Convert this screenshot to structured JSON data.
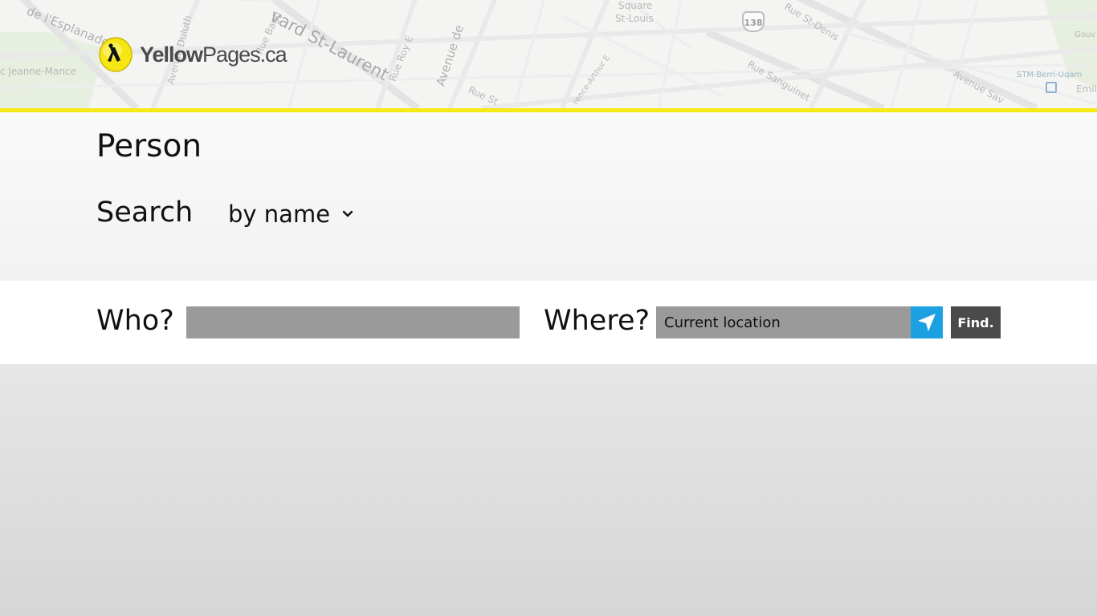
{
  "map": {
    "labels": {
      "esplanade": "de l'Esplanade",
      "jeanne_mance": "c Jeanne-Mance",
      "duluth": "Avenue Duluth",
      "bagg": "Rue Bagg",
      "st_laurent": "vard St-Laurent",
      "roy": "Rue Roy E",
      "avenue_de": "Avenue de",
      "rue_st": "Rue St",
      "arthur": "rence-Arthur E",
      "square": "Square",
      "st_louis": "St-Louis",
      "st_denis": "Rue St-Denis",
      "sanguinet": "Rue Sanguinet",
      "avenue_sav": "Avenue Sav",
      "stm": "STM-Berri-Uqam",
      "emil": "Emil",
      "gouv": "Gouv"
    },
    "route_number": "138",
    "colors": {
      "background": "#f4f4f2",
      "road": "#e6e6e6",
      "park": "#e6efe0"
    }
  },
  "header": {
    "logo": {
      "text_bold": "Yellow",
      "text_regular": "Pages.ca",
      "badge_color": "#f5e614"
    },
    "accent_line_color": "#f5ea14"
  },
  "page": {
    "title": "Person",
    "search_label": "Search",
    "search_mode": {
      "selected": "by name",
      "icon": "chevron-down-icon"
    }
  },
  "search": {
    "who_label": "Who?",
    "who_value": "",
    "where_label": "Where?",
    "where_value": "Current location",
    "locate_icon": "location-arrow-icon",
    "locate_color": "#1ba1e2",
    "find_label": "Find."
  }
}
